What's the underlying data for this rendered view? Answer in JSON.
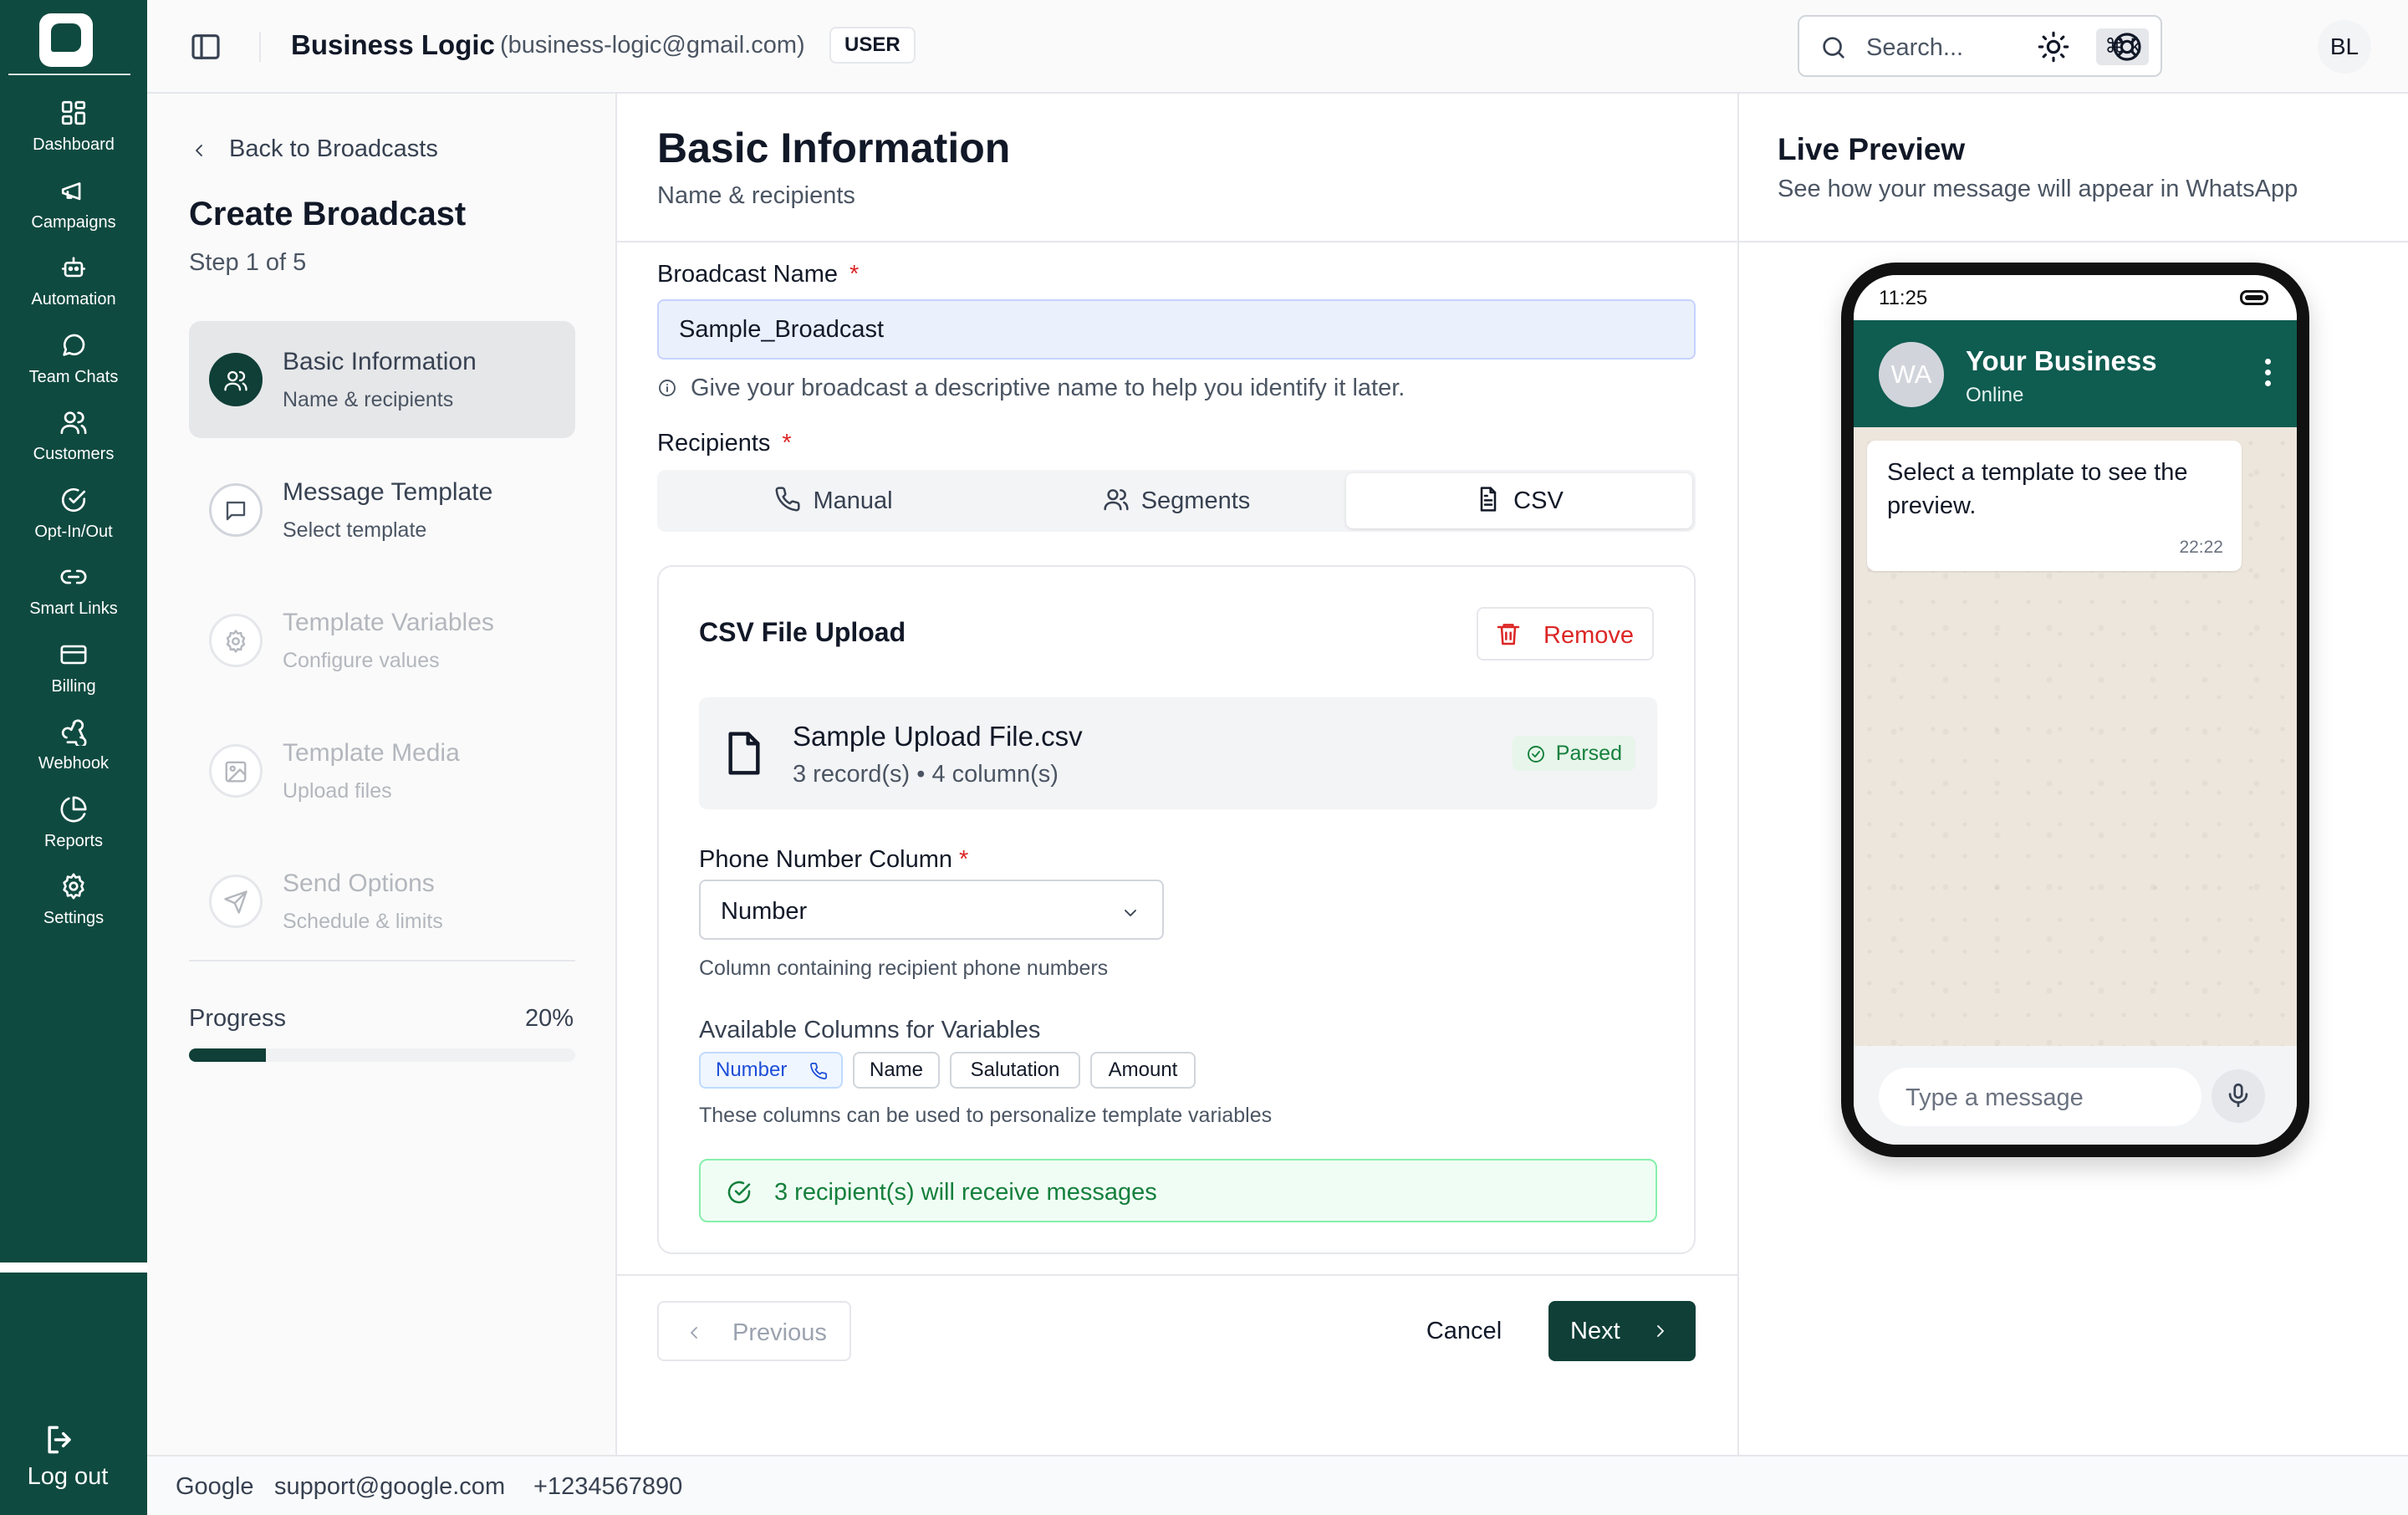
{
  "header": {
    "account_name": "Business Logic",
    "account_email": "(business-logic@gmail.com)",
    "role_badge": "USER",
    "search_placeholder": "Search...",
    "search_shortcut": "⌘ k",
    "avatar_initials": "BL"
  },
  "sidebar": {
    "items": [
      {
        "label": "Dashboard",
        "icon": "grid-icon"
      },
      {
        "label": "Campaigns",
        "icon": "megaphone-icon"
      },
      {
        "label": "Automation",
        "icon": "bot-icon"
      },
      {
        "label": "Team Chats",
        "icon": "chat-icon"
      },
      {
        "label": "Customers",
        "icon": "users-icon"
      },
      {
        "label": "Opt-In/Out",
        "icon": "check-circle-icon"
      },
      {
        "label": "Smart Links",
        "icon": "link-icon"
      },
      {
        "label": "Billing",
        "icon": "credit-card-icon"
      },
      {
        "label": "Webhook",
        "icon": "webhook-icon"
      },
      {
        "label": "Reports",
        "icon": "pie-chart-icon"
      },
      {
        "label": "Settings",
        "icon": "gear-icon"
      }
    ],
    "logout_label": "Log out"
  },
  "steps_panel": {
    "back_label": "Back to Broadcasts",
    "title": "Create Broadcast",
    "step_indicator": "Step 1 of 5",
    "steps": [
      {
        "title": "Basic Information",
        "subtitle": "Name & recipients",
        "icon": "users-icon",
        "state": "active"
      },
      {
        "title": "Message Template",
        "subtitle": "Select template",
        "icon": "message-square-icon",
        "state": "next"
      },
      {
        "title": "Template Variables",
        "subtitle": "Configure values",
        "icon": "gear-icon",
        "state": "disabled"
      },
      {
        "title": "Template Media",
        "subtitle": "Upload files",
        "icon": "image-icon",
        "state": "disabled"
      },
      {
        "title": "Send Options",
        "subtitle": "Schedule & limits",
        "icon": "send-icon",
        "state": "disabled"
      }
    ],
    "progress_label": "Progress",
    "progress_text": "20%",
    "progress_value": 0.2
  },
  "main": {
    "title": "Basic Information",
    "subtitle": "Name & recipients",
    "broadcast_name_label": "Broadcast Name",
    "required_mark": "*",
    "broadcast_name_value": "Sample_Broadcast",
    "broadcast_name_hint": "Give your broadcast a descriptive name to help you identify it later.",
    "recipients_label": "Recipients",
    "recipient_tabs": [
      {
        "label": "Manual",
        "icon": "phone-icon"
      },
      {
        "label": "Segments",
        "icon": "users-icon"
      },
      {
        "label": "CSV",
        "icon": "file-text-icon"
      }
    ],
    "selected_tab": "CSV",
    "csv": {
      "title": "CSV File Upload",
      "remove_label": "Remove",
      "file_name": "Sample Upload File.csv",
      "file_meta": "3 record(s) • 4 column(s)",
      "parsed_label": "Parsed",
      "phone_column_label": "Phone Number Column",
      "phone_column_value": "Number",
      "phone_column_hint": "Column containing recipient phone numbers",
      "available_columns_label": "Available Columns for Variables",
      "columns": [
        "Number",
        "Name",
        "Salutation",
        "Amount"
      ],
      "columns_hint": "These columns can be used to personalize template variables",
      "recipients_summary": "3 recipient(s) will receive messages"
    },
    "previous_label": "Previous",
    "cancel_label": "Cancel",
    "next_label": "Next"
  },
  "preview": {
    "title": "Live Preview",
    "subtitle": "See how your message will appear in WhatsApp",
    "status_time": "11:25",
    "avatar_text": "WA",
    "business_name": "Your Business",
    "business_status": "Online",
    "message_text": "Select a template to see the preview.",
    "message_time": "22:22",
    "input_placeholder": "Type a message"
  },
  "footer": {
    "company": "Google",
    "email": "support@google.com",
    "phone": "+1234567890"
  },
  "colors": {
    "brand_dark": "#0f4a40",
    "whatsapp_header": "#0f5c50",
    "danger": "#dc2626",
    "success": "#15803d"
  }
}
